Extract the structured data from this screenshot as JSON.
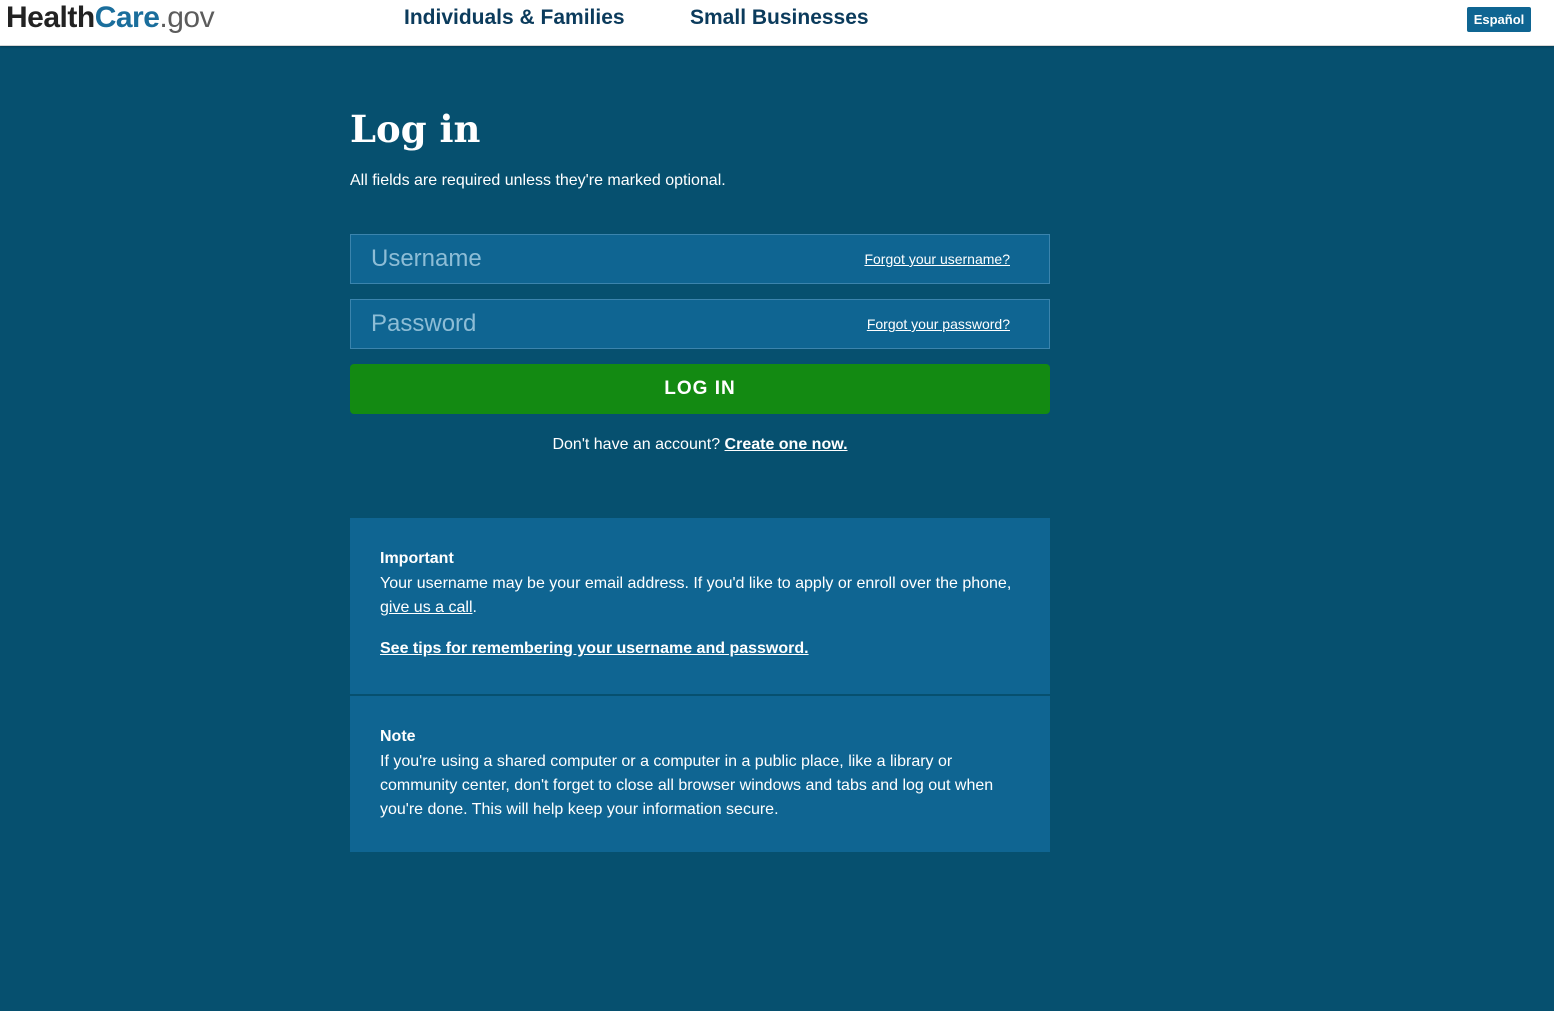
{
  "header": {
    "logo": {
      "health": "Health",
      "care": "Care",
      "gov": ".gov"
    },
    "nav": [
      {
        "label": "Individuals & Families"
      },
      {
        "label": "Small Businesses"
      }
    ],
    "language_button": "Español"
  },
  "login": {
    "title": "Log in",
    "required_note": "All fields are required unless they're marked optional.",
    "username": {
      "placeholder": "Username",
      "value": "",
      "forgot_link": "Forgot your username?"
    },
    "password": {
      "placeholder": "Password",
      "value": "",
      "forgot_link": "Forgot your password?"
    },
    "submit_label": "LOG IN",
    "no_account_text": "Don't have an account? ",
    "create_link": "Create one now."
  },
  "important": {
    "heading": "Important",
    "text_before": "Your username may be your email address. If you'd like to apply or enroll over the phone, ",
    "call_link": "give us a call",
    "text_after": ".",
    "tips_link": "See tips for remembering your username and password."
  },
  "note": {
    "heading": "Note",
    "text": "If you're using a shared computer or a computer in a public place, like a library or community center, don't forget to close all browser windows and tabs and log out when you're done. This will help keep your information secure."
  },
  "colors": {
    "page_background": "#06506f",
    "panel_background": "#0f6592",
    "button_green": "#138a12",
    "nav_text": "#0b3b5c"
  }
}
